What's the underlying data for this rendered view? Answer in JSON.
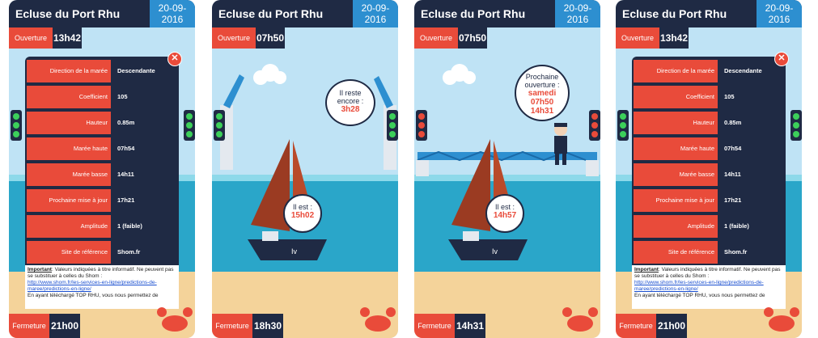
{
  "screens": [
    {
      "title": "Ecluse du Port Rhu",
      "date_line1": "20-09-",
      "date_line2": "2016",
      "open_label": "Ouverture",
      "open_time": "13h42",
      "close_label": "Fermeture",
      "close_time": "21h00",
      "info": {
        "rows": [
          {
            "label": "Direction de la marée",
            "value": "Descendante"
          },
          {
            "label": "Coefficient",
            "value": "105"
          },
          {
            "label": "Hauteur",
            "value": "0.85m"
          },
          {
            "label": "Marée haute",
            "value": "07h54"
          },
          {
            "label": "Marée basse",
            "value": "14h11"
          },
          {
            "label": "Prochaine mise à jour",
            "value": "17h21"
          },
          {
            "label": "Amplitude",
            "value": "1 (faible)"
          },
          {
            "label": "Site de référence",
            "value": "Shom.fr"
          }
        ],
        "note_strong": "Important",
        "note_text": ": Valeurs indiquées à titre informatif. Ne peuvent pas se substituer à celles du Shom :",
        "note_link": "http://www.shom.fr/les-services-en-ligne/predictions-de-maree/predictions-en-ligne/",
        "note_more": "En ayant téléchargé TOP RHU, vous nous permettez de",
        "close_symbol": "✕"
      }
    },
    {
      "title": "Ecluse du Port Rhu",
      "date_line1": "20-09-",
      "date_line2": "2016",
      "open_label": "Ouverture",
      "open_time": "07h50",
      "close_label": "Fermeture",
      "close_time": "18h30",
      "bubble_top_line1": "Il reste",
      "bubble_top_line2": "encore :",
      "bubble_top_highlight": "3h28",
      "bubble_boat_line1": "Il est :",
      "bubble_boat_highlight": "15h02"
    },
    {
      "title": "Ecluse du Port Rhu",
      "date_line1": "20-09-",
      "date_line2": "2016",
      "open_label": "Ouverture",
      "open_time": "07h50",
      "close_label": "Fermeture",
      "close_time": "14h31",
      "bubble_top_line1": "Prochaine",
      "bubble_top_line2": "ouverture :",
      "bubble_top_highlight1": "samedi",
      "bubble_top_highlight2": "07h50",
      "bubble_top_highlight3": "14h31",
      "bubble_boat_line1": "Il est :",
      "bubble_boat_highlight": "14h57"
    },
    {
      "title": "Ecluse du Port Rhu",
      "date_line1": "20-09-",
      "date_line2": "2016",
      "open_label": "Ouverture",
      "open_time": "13h42",
      "close_label": "Fermeture",
      "close_time": "21h00",
      "info": {
        "rows": [
          {
            "label": "Direction de la marée",
            "value": "Descendante"
          },
          {
            "label": "Coefficient",
            "value": "105"
          },
          {
            "label": "Hauteur",
            "value": "0.85m"
          },
          {
            "label": "Marée haute",
            "value": "07h54"
          },
          {
            "label": "Marée basse",
            "value": "14h11"
          },
          {
            "label": "Prochaine mise à jour",
            "value": "17h21"
          },
          {
            "label": "Amplitude",
            "value": "1 (faible)"
          },
          {
            "label": "Site de référence",
            "value": "Shom.fr"
          }
        ],
        "note_strong": "Important",
        "note_text": ": Valeurs indiquées à titre informatif. Ne peuvent pas se substituer à celles du Shom :",
        "note_link": "http://www.shom.fr/les-services-en-ligne/predictions-de-maree/predictions-en-ligne/",
        "note_more": "En ayant téléchargé TOP RHU, vous nous permettez de",
        "close_symbol": "✕"
      }
    }
  ],
  "boat_text": "Iv",
  "colors": {
    "navy": "#1f2a44",
    "red": "#e94b3a",
    "blue": "#2d8fd0",
    "sky": "#bfe3f5",
    "sea": "#2aa6c9",
    "sand": "#f4d39a",
    "light_green": "#3ccf5a",
    "light_red": "#e94b3a"
  }
}
